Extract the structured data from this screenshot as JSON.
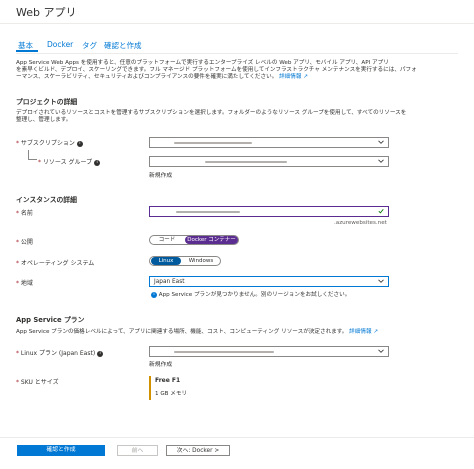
{
  "window": {
    "title": "Web アプリ"
  },
  "tabs": [
    {
      "label": "基本",
      "active": true
    },
    {
      "label": "Docker",
      "active": false
    },
    {
      "label": "タグ",
      "active": false
    },
    {
      "label": "確認と作成",
      "active": false
    }
  ],
  "intro": {
    "line1": "App Service Web Apps を使用すると、任意のプラットフォームで実行するエンタープライズ レベルの Web アプリ、モバイル アプリ、API アプリ",
    "line2": "を素早くビルド、デプロイ、スケーリングできます。フル マネージド プラットフォームを使用してインフラストラクチャ メンテナンスを実行するには、パフォ",
    "line3": "ーマンス、スケーラビリティ、セキュリティおよびコンプライアンスの要件を確実に満たしてください。",
    "link": "詳細情報"
  },
  "project": {
    "heading": "プロジェクトの詳細",
    "desc1": "デプロイされているリソースとコストを管理するサブスクリプションを選択します。フォルダーのようなリソース グループを使用して、すべてのリソースを",
    "desc2": "整理し、管理します。",
    "subscription_label": "サブスクリプション",
    "resource_group_label": "リソース グループ",
    "new_link": "新規作成"
  },
  "instance": {
    "heading": "インスタンスの詳細",
    "name_label": "名前",
    "name_suffix": ".azurewebsites.net",
    "publish_label": "公開",
    "publish_options": [
      "コード",
      "Docker コンテナー"
    ],
    "publish_selected": "Docker コンテナー",
    "os_label": "オペレーティング システム",
    "os_options": [
      "Linux",
      "Windows"
    ],
    "os_selected": "Linux",
    "region_label": "地域",
    "region_value": "Japan East",
    "region_warning": "App Service プランが見つかりません。別のリージョンをお試しください。"
  },
  "plan": {
    "heading": "App Service プラン",
    "desc": "App Service プランの価格レベルによって、アプリに関連する場所、機能、コスト、コンピューティング リソースが決定されます。",
    "desc_link": "詳細情報",
    "linux_plan_label": "Linux プラン (Japan East)",
    "new_link": "新規作成",
    "sku_label": "SKU とサイズ",
    "sku_name": "Free F1",
    "sku_detail": "1 GB メモリ"
  },
  "footer": {
    "review_create": "確認と作成",
    "prev": "前へ",
    "next": "次へ: Docker >"
  },
  "colors": {
    "accent": "#0078d4",
    "purple": "#5c2d91",
    "required": "#a4262c",
    "valid_check": "#107c10"
  }
}
